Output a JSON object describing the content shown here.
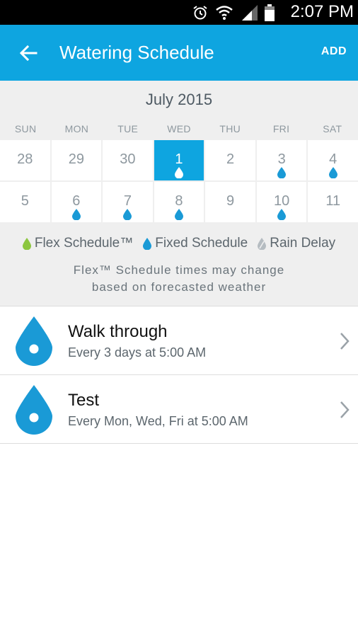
{
  "status_bar": {
    "time": "2:07 PM",
    "icons": [
      "alarm-icon",
      "wifi-icon",
      "signal-icon",
      "battery-icon"
    ]
  },
  "app_bar": {
    "title": "Watering Schedule",
    "add_label": "ADD",
    "back_icon": "arrow-left-icon"
  },
  "calendar": {
    "month": "July 2015",
    "weekdays": [
      "SUN",
      "MON",
      "TUE",
      "WED",
      "THU",
      "FRI",
      "SAT"
    ],
    "days": [
      {
        "num": "28",
        "drop": ""
      },
      {
        "num": "29",
        "drop": ""
      },
      {
        "num": "30",
        "drop": ""
      },
      {
        "num": "1",
        "drop": "white",
        "selected": true
      },
      {
        "num": "2",
        "drop": ""
      },
      {
        "num": "3",
        "drop": "fixed"
      },
      {
        "num": "4",
        "drop": "fixed"
      },
      {
        "num": "5",
        "drop": ""
      },
      {
        "num": "6",
        "drop": "fixed"
      },
      {
        "num": "7",
        "drop": "fixed"
      },
      {
        "num": "8",
        "drop": "fixed"
      },
      {
        "num": "9",
        "drop": ""
      },
      {
        "num": "10",
        "drop": "fixed"
      },
      {
        "num": "11",
        "drop": ""
      }
    ],
    "legend": {
      "flex": "Flex Schedule™",
      "fixed": "Fixed Schedule",
      "rain": "Rain Delay"
    },
    "note_line1": "Flex™ Schedule times may change",
    "note_line2": "based on forecasted weather"
  },
  "colors": {
    "accent": "#0ea5e0",
    "fixed_drop": "#1a9ad6",
    "flex_drop": "#8cc63f",
    "rain_drop": "#b5bcc1"
  },
  "schedules": [
    {
      "name": "Walk through",
      "detail": "Every 3 days at 5:00 AM"
    },
    {
      "name": "Test",
      "detail": "Every Mon, Wed, Fri at 5:00 AM"
    }
  ]
}
